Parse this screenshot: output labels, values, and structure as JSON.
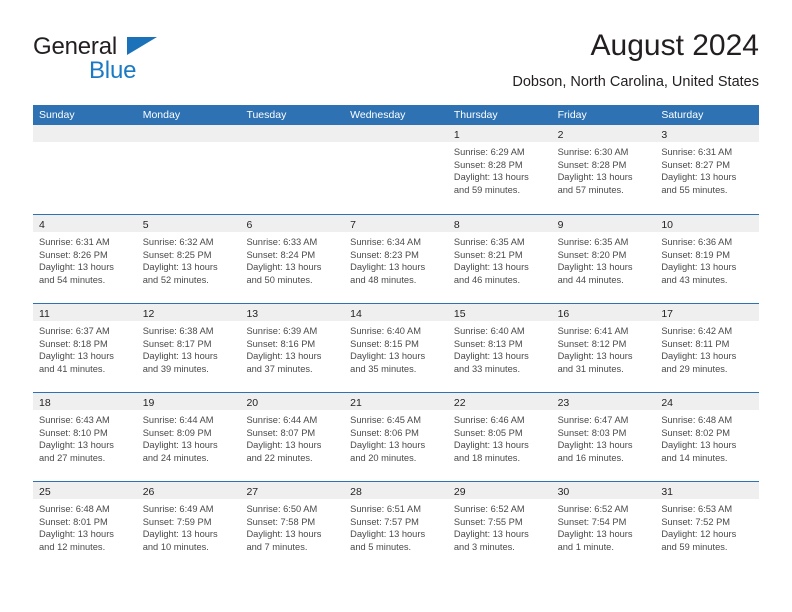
{
  "brand": {
    "name_top": "General",
    "name_bottom": "Blue",
    "triangle_color": "#1b72b8",
    "top_color": "#231f20",
    "bottom_color": "#1b7ac4"
  },
  "header": {
    "title": "August 2024",
    "subtitle": "Dobson, North Carolina, United States"
  },
  "colors": {
    "header_blue": "#2e72b4",
    "daynum_band": "#efefef",
    "text": "#231f20",
    "cell_text": "#4a4a4a"
  },
  "calendar": {
    "weekdays": [
      "Sunday",
      "Monday",
      "Tuesday",
      "Wednesday",
      "Thursday",
      "Friday",
      "Saturday"
    ],
    "weeks": [
      [
        {
          "day": "",
          "lines": []
        },
        {
          "day": "",
          "lines": []
        },
        {
          "day": "",
          "lines": []
        },
        {
          "day": "",
          "lines": []
        },
        {
          "day": "1",
          "lines": [
            "Sunrise: 6:29 AM",
            "Sunset: 8:28 PM",
            "Daylight: 13 hours",
            "and 59 minutes."
          ]
        },
        {
          "day": "2",
          "lines": [
            "Sunrise: 6:30 AM",
            "Sunset: 8:28 PM",
            "Daylight: 13 hours",
            "and 57 minutes."
          ]
        },
        {
          "day": "3",
          "lines": [
            "Sunrise: 6:31 AM",
            "Sunset: 8:27 PM",
            "Daylight: 13 hours",
            "and 55 minutes."
          ]
        }
      ],
      [
        {
          "day": "4",
          "lines": [
            "Sunrise: 6:31 AM",
            "Sunset: 8:26 PM",
            "Daylight: 13 hours",
            "and 54 minutes."
          ]
        },
        {
          "day": "5",
          "lines": [
            "Sunrise: 6:32 AM",
            "Sunset: 8:25 PM",
            "Daylight: 13 hours",
            "and 52 minutes."
          ]
        },
        {
          "day": "6",
          "lines": [
            "Sunrise: 6:33 AM",
            "Sunset: 8:24 PM",
            "Daylight: 13 hours",
            "and 50 minutes."
          ]
        },
        {
          "day": "7",
          "lines": [
            "Sunrise: 6:34 AM",
            "Sunset: 8:23 PM",
            "Daylight: 13 hours",
            "and 48 minutes."
          ]
        },
        {
          "day": "8",
          "lines": [
            "Sunrise: 6:35 AM",
            "Sunset: 8:21 PM",
            "Daylight: 13 hours",
            "and 46 minutes."
          ]
        },
        {
          "day": "9",
          "lines": [
            "Sunrise: 6:35 AM",
            "Sunset: 8:20 PM",
            "Daylight: 13 hours",
            "and 44 minutes."
          ]
        },
        {
          "day": "10",
          "lines": [
            "Sunrise: 6:36 AM",
            "Sunset: 8:19 PM",
            "Daylight: 13 hours",
            "and 43 minutes."
          ]
        }
      ],
      [
        {
          "day": "11",
          "lines": [
            "Sunrise: 6:37 AM",
            "Sunset: 8:18 PM",
            "Daylight: 13 hours",
            "and 41 minutes."
          ]
        },
        {
          "day": "12",
          "lines": [
            "Sunrise: 6:38 AM",
            "Sunset: 8:17 PM",
            "Daylight: 13 hours",
            "and 39 minutes."
          ]
        },
        {
          "day": "13",
          "lines": [
            "Sunrise: 6:39 AM",
            "Sunset: 8:16 PM",
            "Daylight: 13 hours",
            "and 37 minutes."
          ]
        },
        {
          "day": "14",
          "lines": [
            "Sunrise: 6:40 AM",
            "Sunset: 8:15 PM",
            "Daylight: 13 hours",
            "and 35 minutes."
          ]
        },
        {
          "day": "15",
          "lines": [
            "Sunrise: 6:40 AM",
            "Sunset: 8:13 PM",
            "Daylight: 13 hours",
            "and 33 minutes."
          ]
        },
        {
          "day": "16",
          "lines": [
            "Sunrise: 6:41 AM",
            "Sunset: 8:12 PM",
            "Daylight: 13 hours",
            "and 31 minutes."
          ]
        },
        {
          "day": "17",
          "lines": [
            "Sunrise: 6:42 AM",
            "Sunset: 8:11 PM",
            "Daylight: 13 hours",
            "and 29 minutes."
          ]
        }
      ],
      [
        {
          "day": "18",
          "lines": [
            "Sunrise: 6:43 AM",
            "Sunset: 8:10 PM",
            "Daylight: 13 hours",
            "and 27 minutes."
          ]
        },
        {
          "day": "19",
          "lines": [
            "Sunrise: 6:44 AM",
            "Sunset: 8:09 PM",
            "Daylight: 13 hours",
            "and 24 minutes."
          ]
        },
        {
          "day": "20",
          "lines": [
            "Sunrise: 6:44 AM",
            "Sunset: 8:07 PM",
            "Daylight: 13 hours",
            "and 22 minutes."
          ]
        },
        {
          "day": "21",
          "lines": [
            "Sunrise: 6:45 AM",
            "Sunset: 8:06 PM",
            "Daylight: 13 hours",
            "and 20 minutes."
          ]
        },
        {
          "day": "22",
          "lines": [
            "Sunrise: 6:46 AM",
            "Sunset: 8:05 PM",
            "Daylight: 13 hours",
            "and 18 minutes."
          ]
        },
        {
          "day": "23",
          "lines": [
            "Sunrise: 6:47 AM",
            "Sunset: 8:03 PM",
            "Daylight: 13 hours",
            "and 16 minutes."
          ]
        },
        {
          "day": "24",
          "lines": [
            "Sunrise: 6:48 AM",
            "Sunset: 8:02 PM",
            "Daylight: 13 hours",
            "and 14 minutes."
          ]
        }
      ],
      [
        {
          "day": "25",
          "lines": [
            "Sunrise: 6:48 AM",
            "Sunset: 8:01 PM",
            "Daylight: 13 hours",
            "and 12 minutes."
          ]
        },
        {
          "day": "26",
          "lines": [
            "Sunrise: 6:49 AM",
            "Sunset: 7:59 PM",
            "Daylight: 13 hours",
            "and 10 minutes."
          ]
        },
        {
          "day": "27",
          "lines": [
            "Sunrise: 6:50 AM",
            "Sunset: 7:58 PM",
            "Daylight: 13 hours",
            "and 7 minutes."
          ]
        },
        {
          "day": "28",
          "lines": [
            "Sunrise: 6:51 AM",
            "Sunset: 7:57 PM",
            "Daylight: 13 hours",
            "and 5 minutes."
          ]
        },
        {
          "day": "29",
          "lines": [
            "Sunrise: 6:52 AM",
            "Sunset: 7:55 PM",
            "Daylight: 13 hours",
            "and 3 minutes."
          ]
        },
        {
          "day": "30",
          "lines": [
            "Sunrise: 6:52 AM",
            "Sunset: 7:54 PM",
            "Daylight: 13 hours",
            "and 1 minute."
          ]
        },
        {
          "day": "31",
          "lines": [
            "Sunrise: 6:53 AM",
            "Sunset: 7:52 PM",
            "Daylight: 12 hours",
            "and 59 minutes."
          ]
        }
      ]
    ]
  }
}
